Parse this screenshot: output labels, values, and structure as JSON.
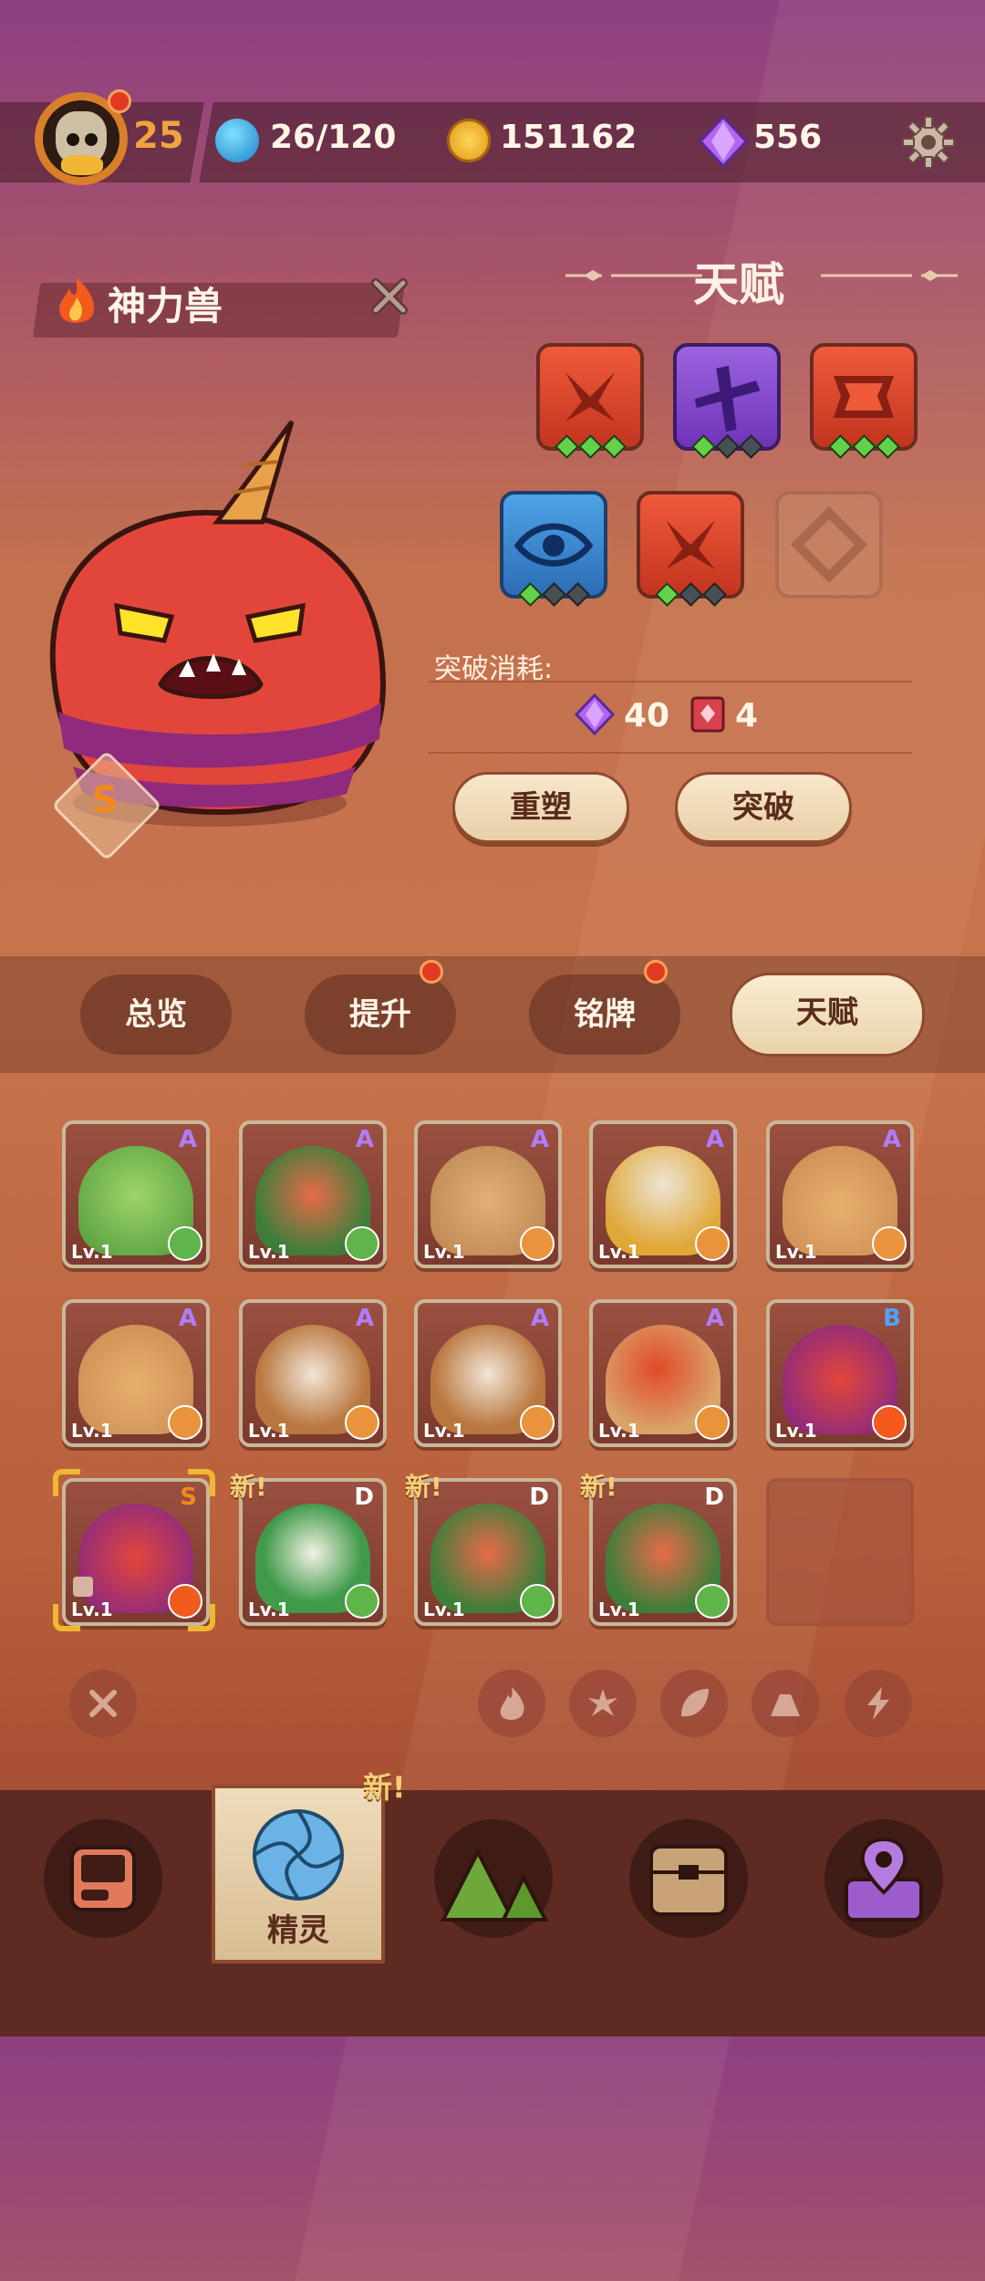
{
  "top_bar": {
    "player_level": "25",
    "energy": "26/120",
    "coins": "151162",
    "gems": "556"
  },
  "monster": {
    "name": "神力兽",
    "rank": "S"
  },
  "talent": {
    "title": "天赋",
    "cost_label": "突破消耗:",
    "cost_gems": "40",
    "cost_books": "4",
    "reset_button": "重塑",
    "breakthrough_button": "突破"
  },
  "tabs": [
    {
      "label": "总览"
    },
    {
      "label": "提升"
    },
    {
      "label": "铭牌"
    },
    {
      "label": "天赋"
    }
  ],
  "roster": [
    {
      "level": "Lv.1",
      "rank": "A"
    },
    {
      "level": "Lv.1",
      "rank": "A"
    },
    {
      "level": "Lv.1",
      "rank": "A"
    },
    {
      "level": "Lv.1",
      "rank": "A"
    },
    {
      "level": "Lv.1",
      "rank": "A"
    },
    {
      "level": "Lv.1",
      "rank": "A"
    },
    {
      "level": "Lv.1",
      "rank": "A"
    },
    {
      "level": "Lv.1",
      "rank": "A"
    },
    {
      "level": "Lv.1",
      "rank": "A"
    },
    {
      "level": "Lv.1",
      "rank": "B"
    },
    {
      "level": "Lv.1",
      "rank": "S"
    },
    {
      "level": "Lv.1",
      "rank": "D"
    },
    {
      "level": "Lv.1",
      "rank": "D"
    },
    {
      "level": "Lv.1",
      "rank": "D"
    }
  ],
  "new_tag": "新!",
  "bottom_nav": {
    "active_label": "精灵"
  }
}
